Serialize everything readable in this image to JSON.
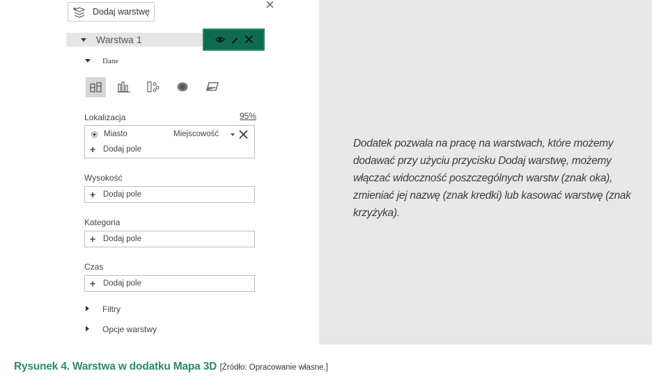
{
  "pane": {
    "add_layer_label": "Dodaj warstwę",
    "layer_name": "Warstwa 1",
    "section_data": "Dane",
    "location": {
      "label": "Lokalizacja",
      "confidence": "95%",
      "field_name": "Miasto",
      "field_type": "Miejscowość",
      "add_field": "Dodaj pole"
    },
    "height": {
      "label": "Wysokość",
      "add_field": "Dodaj pole"
    },
    "category": {
      "label": "Kategoria",
      "add_field": "Dodaj pole"
    },
    "time": {
      "label": "Czas",
      "add_field": "Dodaj pole"
    },
    "filters_label": "Filtry",
    "layer_options_label": "Opcje warstwy",
    "highlight_color": "#0e6b4f",
    "highlight_border": "#1f8a5e"
  },
  "note": {
    "text": "Dodatek pozwala na pracę na warstwach, które możemy dodawać przy użyciu przycisku Dodaj warstwę, możemy włączać widoczność poszczególnych warstw (znak oka), zmieniać jej nazwę (znak kredki) lub kasować warstwę (znak krzyżyka)."
  },
  "caption": {
    "title": "Rysunek 4. Warstwa w dodatku Mapa 3D",
    "source": "[Źródło: Opracowanie własne.]"
  }
}
